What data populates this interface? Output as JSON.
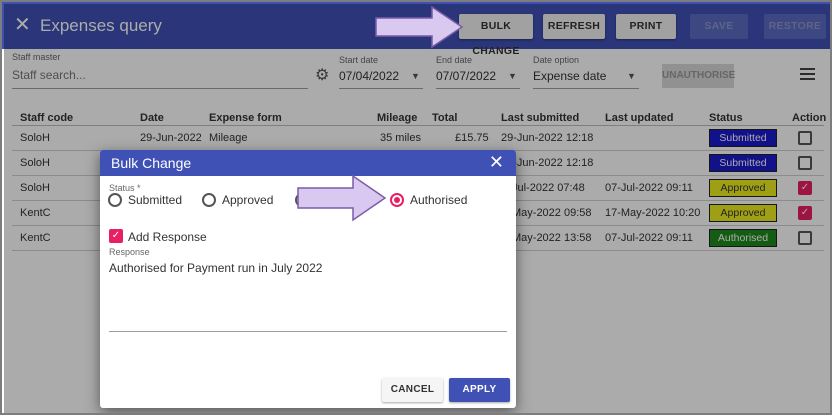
{
  "header": {
    "close_glyph": "✕",
    "title": "Expenses query",
    "buttons": {
      "bulk_change": "BULK CHANGE",
      "refresh": "REFRESH",
      "print": "PRINT",
      "save": "SAVE",
      "restore": "RESTORE"
    }
  },
  "filters": {
    "staff_master_label": "Staff master",
    "staff_placeholder": "Staff search...",
    "start_date_label": "Start date",
    "start_date": "07/04/2022",
    "end_date_label": "End date",
    "end_date": "07/07/2022",
    "date_option_label": "Date option",
    "date_option": "Expense date",
    "unauthorise": "UNAUTHORISE"
  },
  "table": {
    "headers": [
      "Staff code",
      "Date",
      "Expense form",
      "Mileage",
      "Total",
      "Last submitted",
      "Last updated",
      "Status",
      "Action"
    ],
    "rows": [
      {
        "staff": "SoloH",
        "date": "29-Jun-2022",
        "form": "Mileage",
        "mileage": "35 miles",
        "total": "£15.75",
        "submitted": "29-Jun-2022 12:18",
        "updated": "",
        "status": "Submitted",
        "checked": false
      },
      {
        "staff": "SoloH",
        "date": "",
        "form": "",
        "mileage": "",
        "total": "",
        "submitted": "29-Jun-2022 12:18",
        "updated": "",
        "status": "Submitted",
        "checked": false
      },
      {
        "staff": "SoloH",
        "date": "",
        "form": "",
        "mileage": "",
        "total": "",
        "submitted": "Jul-2022 07:48",
        "updated": "07-Jul-2022 09:11",
        "status": "Approved",
        "checked": true
      },
      {
        "staff": "KentC",
        "date": "",
        "form": "",
        "mileage": "",
        "total": "",
        "submitted": "May-2022 09:58",
        "updated": "17-May-2022 10:20",
        "status": "Approved",
        "checked": true
      },
      {
        "staff": "KentC",
        "date": "",
        "form": "",
        "mileage": "",
        "total": "",
        "submitted": "May-2022 13:58",
        "updated": "07-Jul-2022 09:11",
        "status": "Authorised",
        "checked": false
      }
    ]
  },
  "dialog": {
    "title": "Bulk Change",
    "close_glyph": "✕",
    "status_label": "Status *",
    "options": [
      "Submitted",
      "Approved",
      "Authorised"
    ],
    "selected": "Authorised",
    "add_response_label": "Add Response",
    "response_label": "Response",
    "response_text": "Authorised for Payment run in July 2022",
    "cancel": "CANCEL",
    "apply": "APPLY"
  },
  "colors": {
    "primary": "#3f51b5",
    "accent": "#e91e63",
    "status_submitted": "#1a1acc",
    "status_approved": "#eeee22",
    "status_authorised": "#1e8a1e",
    "callout_arrow": "#d9c8f0"
  },
  "icons": [
    "close-icon",
    "gear-icon",
    "chevron-down-icon",
    "menu-icon",
    "check-icon"
  ]
}
